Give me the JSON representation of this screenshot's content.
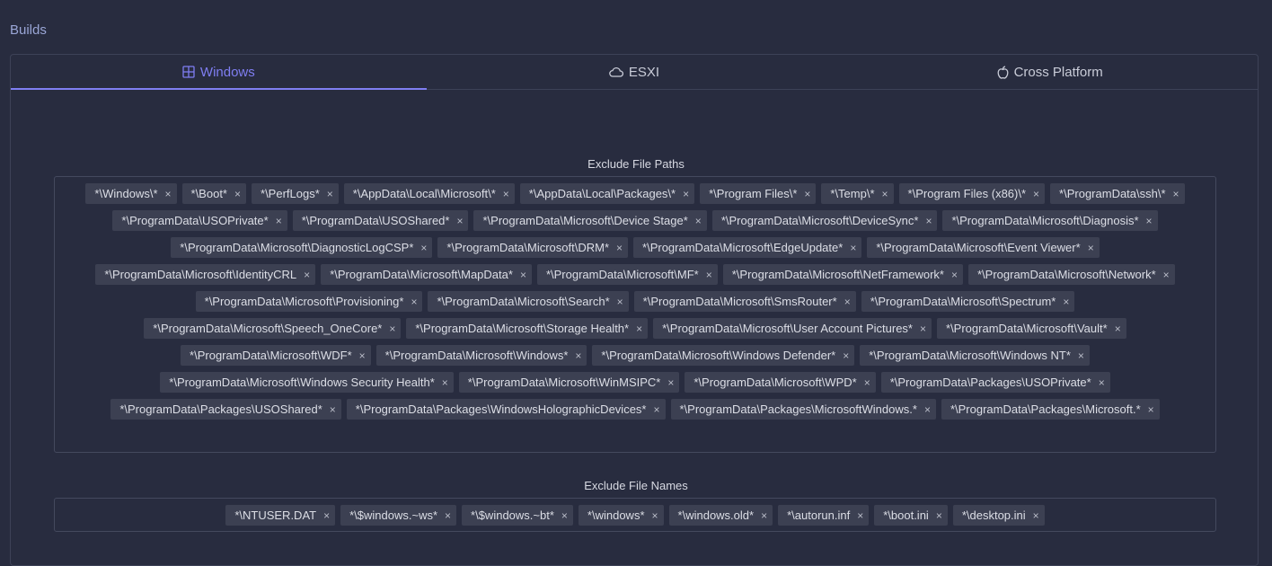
{
  "section_title": "Builds",
  "tabs": [
    {
      "label": "Windows",
      "icon": "windows-icon",
      "active": true
    },
    {
      "label": "ESXI",
      "icon": "cloud-icon",
      "active": false
    },
    {
      "label": "Cross Platform",
      "icon": "apple-icon",
      "active": false
    }
  ],
  "colors": {
    "background": "#282c3f",
    "accent": "#7f7ef2",
    "tag_bg": "#3c4052",
    "border": "#3d4257"
  },
  "exclude_paths": {
    "label": "Exclude File Paths",
    "tags": [
      "*\\Windows\\*",
      "*\\Boot*",
      "*\\PerfLogs*",
      "*\\AppData\\Local\\Microsoft\\*",
      "*\\AppData\\Local\\Packages\\*",
      "*\\Program Files\\*",
      "*\\Temp\\*",
      "*\\Program Files (x86)\\*",
      "*\\ProgramData\\ssh\\*",
      "*\\ProgramData\\USOPrivate*",
      "*\\ProgramData\\USOShared*",
      "*\\ProgramData\\Microsoft\\Device Stage*",
      "*\\ProgramData\\Microsoft\\DeviceSync*",
      "*\\ProgramData\\Microsoft\\Diagnosis*",
      "*\\ProgramData\\Microsoft\\DiagnosticLogCSP*",
      "*\\ProgramData\\Microsoft\\DRM*",
      "*\\ProgramData\\Microsoft\\EdgeUpdate*",
      "*\\ProgramData\\Microsoft\\Event Viewer*",
      "*\\ProgramData\\Microsoft\\IdentityCRL",
      "*\\ProgramData\\Microsoft\\MapData*",
      "*\\ProgramData\\Microsoft\\MF*",
      "*\\ProgramData\\Microsoft\\NetFramework*",
      "*\\ProgramData\\Microsoft\\Network*",
      "*\\ProgramData\\Microsoft\\Provisioning*",
      "*\\ProgramData\\Microsoft\\Search*",
      "*\\ProgramData\\Microsoft\\SmsRouter*",
      "*\\ProgramData\\Microsoft\\Spectrum*",
      "*\\ProgramData\\Microsoft\\Speech_OneCore*",
      "*\\ProgramData\\Microsoft\\Storage Health*",
      "*\\ProgramData\\Microsoft\\User Account Pictures*",
      "*\\ProgramData\\Microsoft\\Vault*",
      "*\\ProgramData\\Microsoft\\WDF*",
      "*\\ProgramData\\Microsoft\\Windows*",
      "*\\ProgramData\\Microsoft\\Windows Defender*",
      "*\\ProgramData\\Microsoft\\Windows NT*",
      "*\\ProgramData\\Microsoft\\Windows Security Health*",
      "*\\ProgramData\\Microsoft\\WinMSIPC*",
      "*\\ProgramData\\Microsoft\\WPD*",
      "*\\ProgramData\\Packages\\USOPrivate*",
      "*\\ProgramData\\Packages\\USOShared*",
      "*\\ProgramData\\Packages\\WindowsHolographicDevices*",
      "*\\ProgramData\\Packages\\MicrosoftWindows.*",
      "*\\ProgramData\\Packages\\Microsoft.*"
    ]
  },
  "exclude_names": {
    "label": "Exclude File Names",
    "tags": [
      "*\\NTUSER.DAT",
      "*\\$windows.~ws*",
      "*\\$windows.~bt*",
      "*\\windows*",
      "*\\windows.old*",
      "*\\autorun.inf",
      "*\\boot.ini",
      "*\\desktop.ini"
    ]
  },
  "remove_glyph": "×"
}
